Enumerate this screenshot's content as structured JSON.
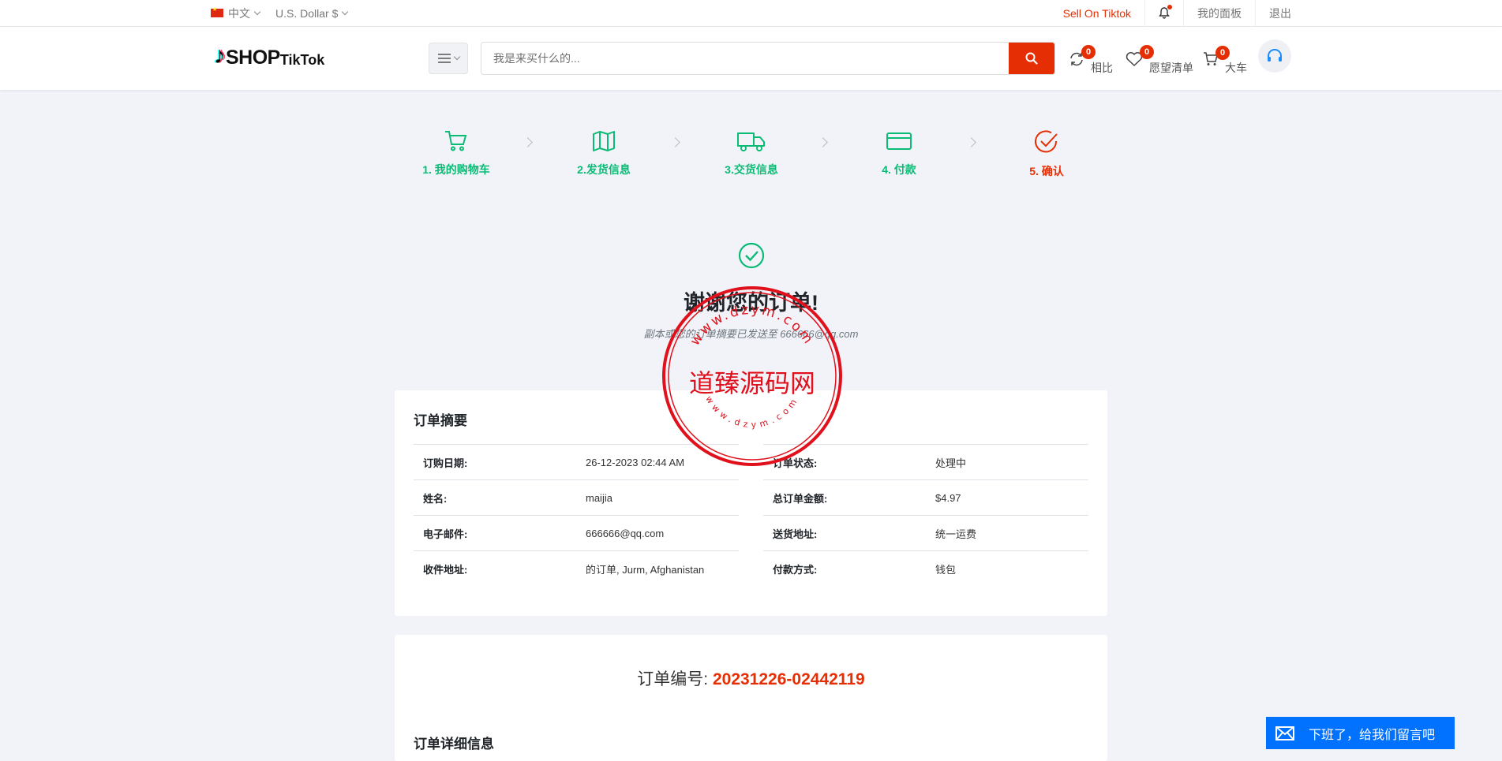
{
  "topbar": {
    "language": "中文",
    "currency": "U.S. Dollar $",
    "sell_link": "Sell On Tiktok",
    "dashboard": "我的面板",
    "logout": "退出"
  },
  "header": {
    "logo": {
      "shop": "SHOP",
      "tiktok": "TikTok"
    },
    "search_placeholder": "我是来买什么的...",
    "compare": {
      "label": "相比",
      "count": "0"
    },
    "wishlist": {
      "label": "愿望清单",
      "count": "0"
    },
    "cart": {
      "label": "大车",
      "count": "0"
    }
  },
  "steps": [
    {
      "label": "1. 我的购物车",
      "icon": "cart-icon"
    },
    {
      "label": "2.发货信息",
      "icon": "map-icon"
    },
    {
      "label": "3.交货信息",
      "icon": "truck-icon"
    },
    {
      "label": "4. 付款",
      "icon": "credit-card-icon"
    },
    {
      "label": "5. 确认",
      "icon": "check-circle-icon"
    }
  ],
  "thanks": {
    "title": "谢谢您的订单!",
    "subtitle": "副本或您的订单摘要已发送至 666666@qq.com"
  },
  "summary": {
    "title": "订单摘要",
    "left": [
      {
        "key": "订购日期:",
        "value": "26-12-2023 02:44 AM"
      },
      {
        "key": "姓名:",
        "value": "maijia"
      },
      {
        "key": "电子邮件:",
        "value": "666666@qq.com"
      },
      {
        "key": "收件地址:",
        "value": "的订单, Jurm, Afghanistan"
      }
    ],
    "right": [
      {
        "key": "订单状态:",
        "value": "处理中"
      },
      {
        "key": "总订单金额:",
        "value": "$4.97"
      },
      {
        "key": "送货地址:",
        "value": "统一运费"
      },
      {
        "key": "付款方式:",
        "value": "钱包"
      }
    ]
  },
  "order": {
    "number_label": "订单编号:",
    "number": "20231226-02442119",
    "details_title": "订单详细信息"
  },
  "stamp": {
    "center": "道臻源码网",
    "ring_top": "www.dzym.com",
    "ring_bottom": "www.dzym.com",
    "color": "#e0111c"
  },
  "chat": {
    "label": "下班了，给我们留言吧"
  },
  "colors": {
    "accent": "#e62e04",
    "success": "#0abb75",
    "chat": "#0072ff"
  }
}
